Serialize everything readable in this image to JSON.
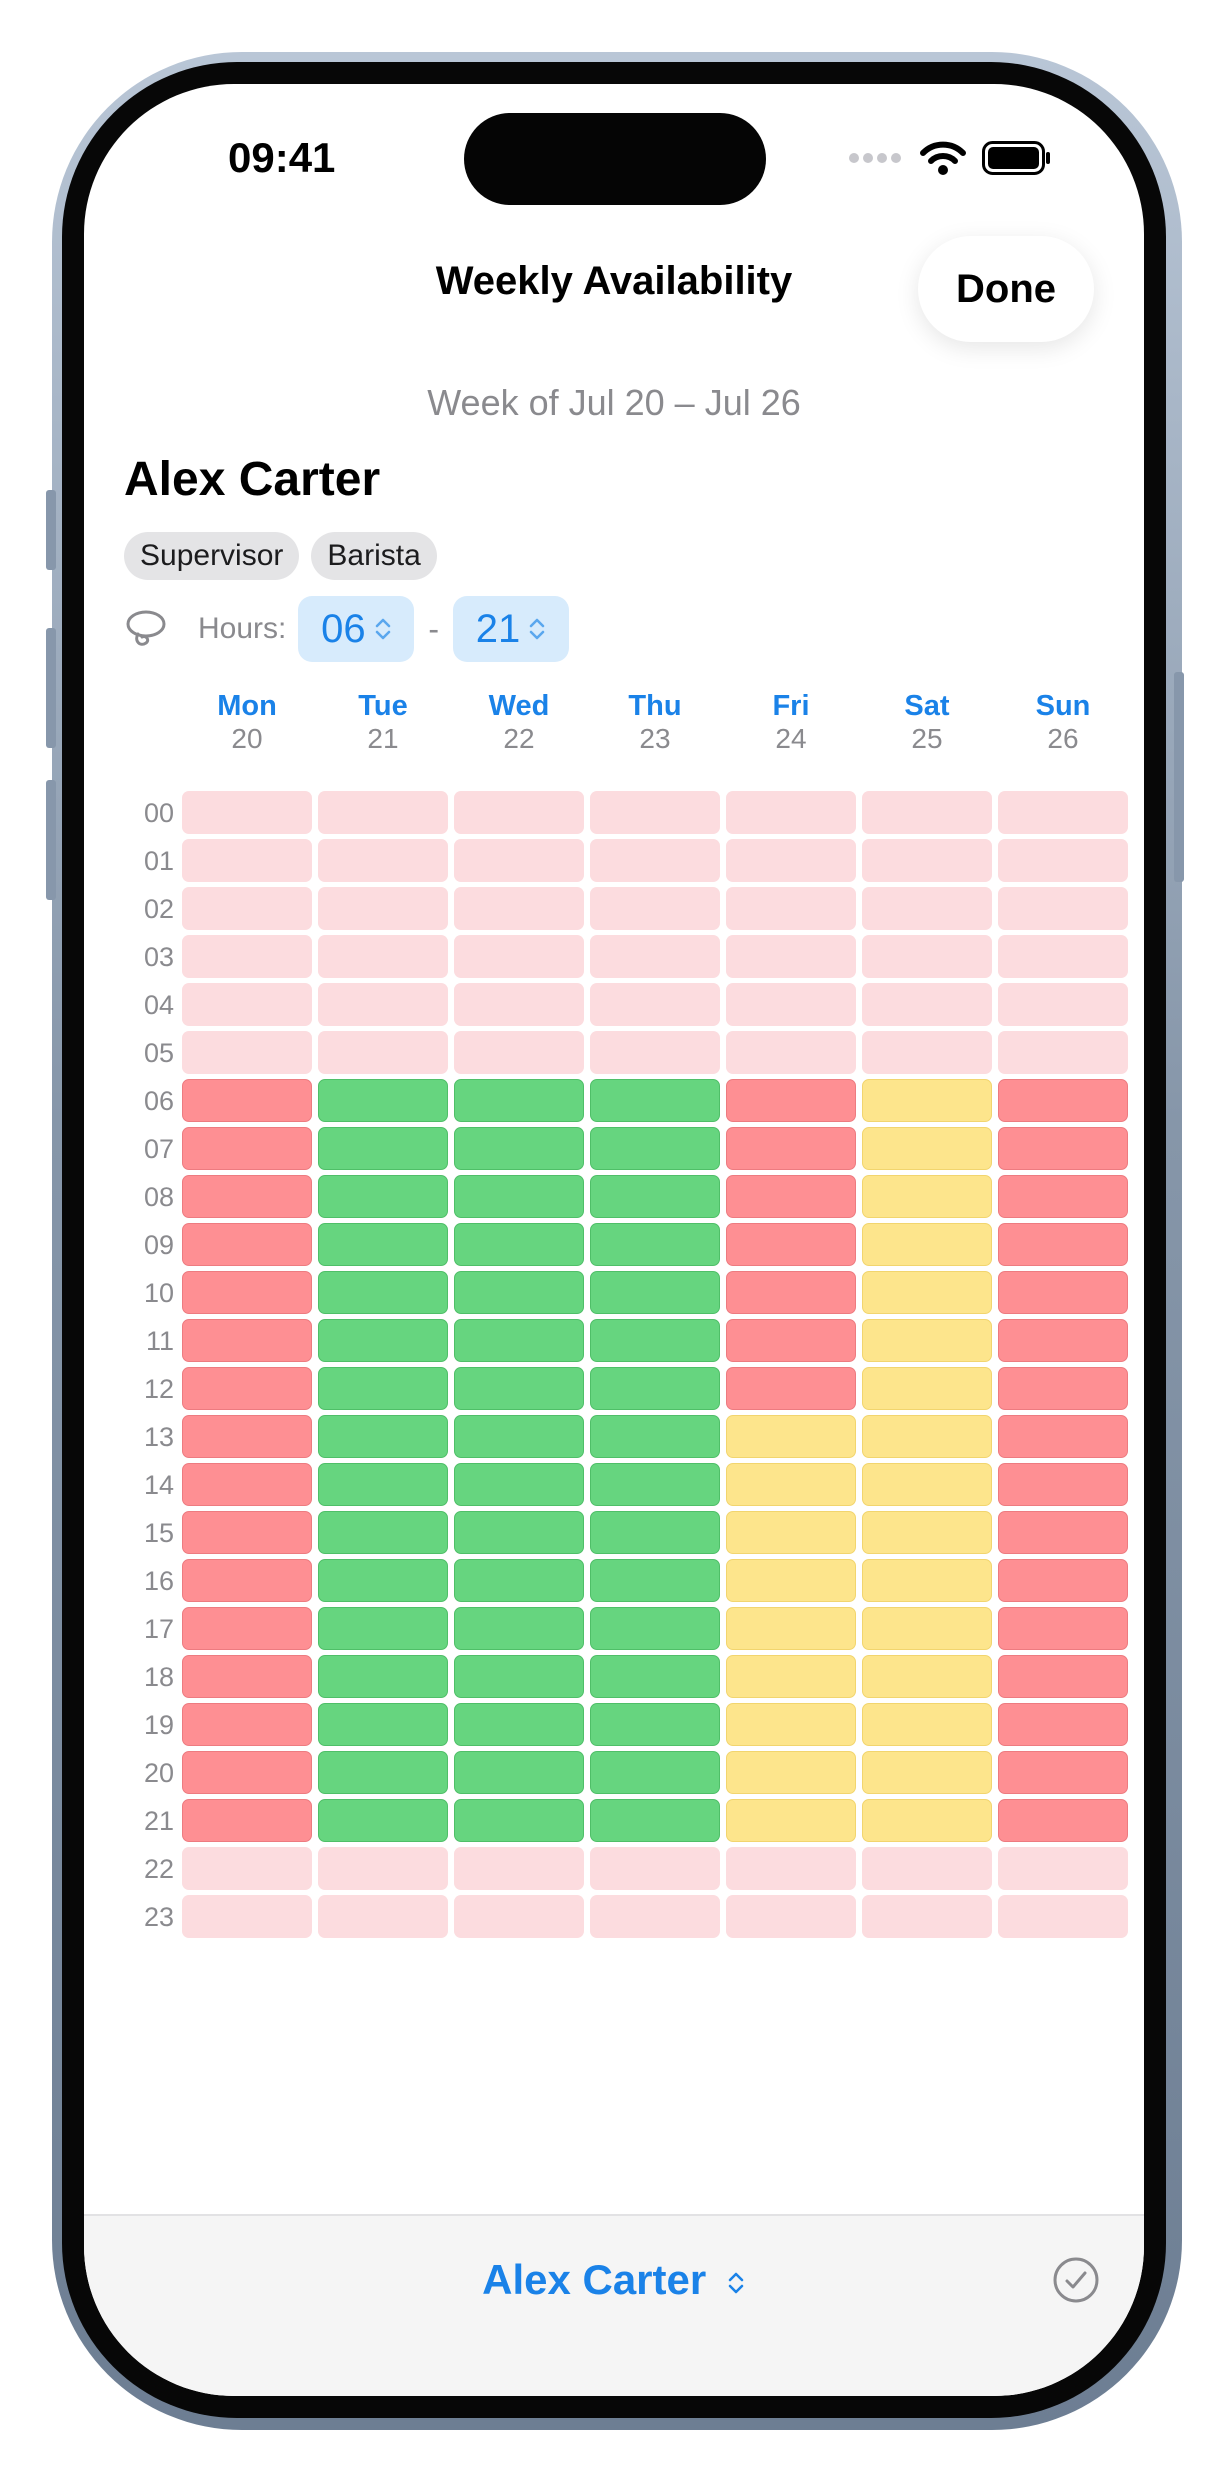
{
  "status_bar": {
    "time": "09:41"
  },
  "nav": {
    "title": "Weekly Availability",
    "done_label": "Done"
  },
  "week_label": "Week of Jul 20 – Jul 26",
  "employee": {
    "name": "Alex Carter",
    "roles": [
      "Supervisor",
      "Barista"
    ]
  },
  "hours": {
    "label": "Hours:",
    "start": "06",
    "end": "21",
    "separator": "-"
  },
  "days": [
    {
      "name": "Mon",
      "date": "20"
    },
    {
      "name": "Tue",
      "date": "21"
    },
    {
      "name": "Wed",
      "date": "22"
    },
    {
      "name": "Thu",
      "date": "23"
    },
    {
      "name": "Fri",
      "date": "24"
    },
    {
      "name": "Sat",
      "date": "25"
    },
    {
      "name": "Sun",
      "date": "26"
    }
  ],
  "hour_labels": [
    "00",
    "01",
    "02",
    "03",
    "04",
    "05",
    "06",
    "07",
    "08",
    "09",
    "10",
    "11",
    "12",
    "13",
    "14",
    "15",
    "16",
    "17",
    "18",
    "19",
    "20",
    "21",
    "22",
    "23"
  ],
  "availability": {
    "legend_colors": {
      "outside_hours": "#fcdcdf",
      "unavailable": "#fe8f93",
      "available": "#66d57f",
      "maybe": "#fde58c"
    },
    "grid": [
      [
        "off",
        "off",
        "off",
        "off",
        "off",
        "off",
        "off"
      ],
      [
        "off",
        "off",
        "off",
        "off",
        "off",
        "off",
        "off"
      ],
      [
        "off",
        "off",
        "off",
        "off",
        "off",
        "off",
        "off"
      ],
      [
        "off",
        "off",
        "off",
        "off",
        "off",
        "off",
        "off"
      ],
      [
        "off",
        "off",
        "off",
        "off",
        "off",
        "off",
        "off"
      ],
      [
        "off",
        "off",
        "off",
        "off",
        "off",
        "off",
        "off"
      ],
      [
        "red",
        "green",
        "green",
        "green",
        "red",
        "yellow",
        "red"
      ],
      [
        "red",
        "green",
        "green",
        "green",
        "red",
        "yellow",
        "red"
      ],
      [
        "red",
        "green",
        "green",
        "green",
        "red",
        "yellow",
        "red"
      ],
      [
        "red",
        "green",
        "green",
        "green",
        "red",
        "yellow",
        "red"
      ],
      [
        "red",
        "green",
        "green",
        "green",
        "red",
        "yellow",
        "red"
      ],
      [
        "red",
        "green",
        "green",
        "green",
        "red",
        "yellow",
        "red"
      ],
      [
        "red",
        "green",
        "green",
        "green",
        "red",
        "yellow",
        "red"
      ],
      [
        "red",
        "green",
        "green",
        "green",
        "yellow",
        "yellow",
        "red"
      ],
      [
        "red",
        "green",
        "green",
        "green",
        "yellow",
        "yellow",
        "red"
      ],
      [
        "red",
        "green",
        "green",
        "green",
        "yellow",
        "yellow",
        "red"
      ],
      [
        "red",
        "green",
        "green",
        "green",
        "yellow",
        "yellow",
        "red"
      ],
      [
        "red",
        "green",
        "green",
        "green",
        "yellow",
        "yellow",
        "red"
      ],
      [
        "red",
        "green",
        "green",
        "green",
        "yellow",
        "yellow",
        "red"
      ],
      [
        "red",
        "green",
        "green",
        "green",
        "yellow",
        "yellow",
        "red"
      ],
      [
        "red",
        "green",
        "green",
        "green",
        "yellow",
        "yellow",
        "red"
      ],
      [
        "red",
        "green",
        "green",
        "green",
        "yellow",
        "yellow",
        "red"
      ],
      [
        "off",
        "off",
        "off",
        "off",
        "off",
        "off",
        "off"
      ],
      [
        "off",
        "off",
        "off",
        "off",
        "off",
        "off",
        "off"
      ]
    ]
  },
  "bottom_bar": {
    "selected_employee": "Alex Carter"
  },
  "icons": {
    "lasso": "lasso-icon",
    "chevron": "chevron-up-down-icon",
    "check": "checkmark-circle-icon"
  },
  "accent_color": "#1a82e8"
}
